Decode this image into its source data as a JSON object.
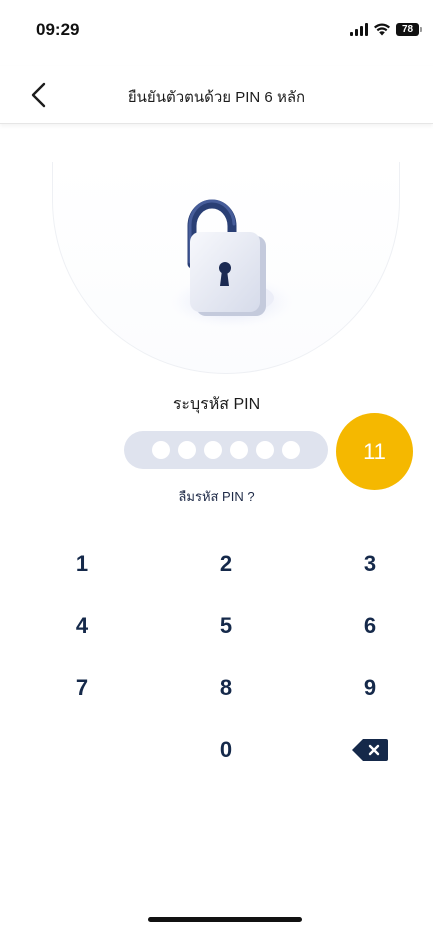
{
  "status_bar": {
    "time": "09:29",
    "battery": "78",
    "icons": [
      "signal-icon",
      "wifi-icon",
      "battery-icon"
    ]
  },
  "header": {
    "title": "ยืนยันตัวตนด้วย PIN 6 หลัก",
    "back_icon": "chevron-left-icon"
  },
  "pin": {
    "label": "ระบุรหัส PIN",
    "length": 6,
    "forgot_label": "ลืมรหัส PIN ?"
  },
  "badge": {
    "text": "11",
    "color": "#f5b800"
  },
  "keypad": {
    "keys": [
      "1",
      "2",
      "3",
      "4",
      "5",
      "6",
      "7",
      "8",
      "9",
      "0"
    ],
    "backspace_icon": "backspace-icon"
  },
  "colors": {
    "key_text": "#15294a",
    "pin_field": "#dfe3ee",
    "lock_body": "#e9ecf5",
    "shackle": "#2a3f75"
  }
}
